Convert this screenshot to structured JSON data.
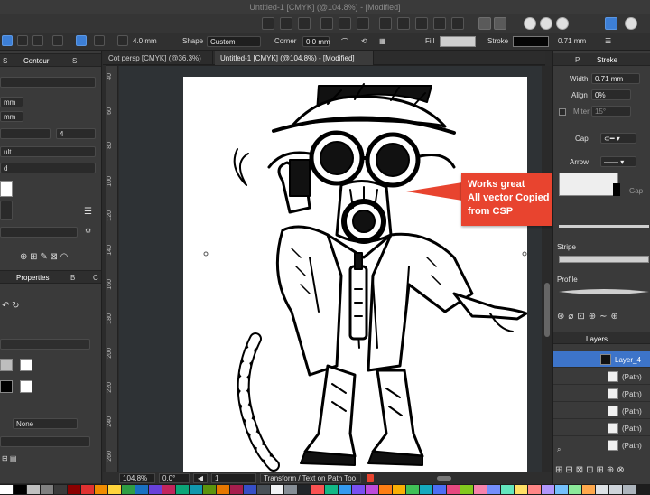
{
  "window": {
    "title": "Untitled-1 [CMYK] (@104.8%) - [Modified]"
  },
  "context": {
    "size_value": "4.0 mm",
    "shape_label": "Shape",
    "shape_value": "Custom",
    "corner_label": "Corner",
    "corner_value": "0.0 mm",
    "fill_label": "Fill",
    "stroke_label": "Stroke",
    "stroke_width": "0.71 mm"
  },
  "doc_tabs": [
    {
      "label": "Cot persp [CMYK] (@36.3%)"
    },
    {
      "label": "Untitled-1 [CMYK] (@104.8%) - [Modified]"
    }
  ],
  "left_panel": {
    "tab_s": "S",
    "tab_contour": "Contour",
    "tab_s2": "S",
    "field_mm1": "mm",
    "field_mm2": "mm",
    "dropdown_value": "4",
    "dropdown_ult": "ult",
    "dropdown_d": "d",
    "tab_properties": "Properties",
    "tab_b": "B",
    "tab_c": "C",
    "blend_value": "None"
  },
  "ruler_ticks": [
    "40",
    "60",
    "80",
    "100",
    "120",
    "140",
    "160",
    "180",
    "200",
    "220",
    "240",
    "260"
  ],
  "callout": {
    "line1": "Works great",
    "line2": "All vector Copied as SVG",
    "line3": "from CSP"
  },
  "status": {
    "zoom": "104.8%",
    "rotation": "0.0°",
    "page": "1",
    "tool_hint": "Transform / Text on Path Too"
  },
  "right_panel": {
    "tab_p": "P",
    "tab_stroke": "Stroke",
    "width_label": "Width",
    "width_value": "0.71 mm",
    "align_label": "Align",
    "align_value": "0%",
    "miter_label": "Miter",
    "miter_value": "15°",
    "cap_label": "Cap",
    "arrow_label": "Arrow",
    "gap_label": "Gap",
    "stripe_label": "Stripe",
    "profile_label": "Profile",
    "layers_tab": "Layers",
    "layers": [
      {
        "name": "Layer_4",
        "selected": true
      },
      {
        "name": "(Path)",
        "selected": false
      },
      {
        "name": "(Path)",
        "selected": false
      },
      {
        "name": "(Path)",
        "selected": false
      },
      {
        "name": "(Path)",
        "selected": false
      },
      {
        "name": "(Path)",
        "selected": false
      }
    ]
  },
  "colors": {
    "accent": "#3d74c9",
    "callout": "#e8442f",
    "panel": "#3a3a3a"
  }
}
